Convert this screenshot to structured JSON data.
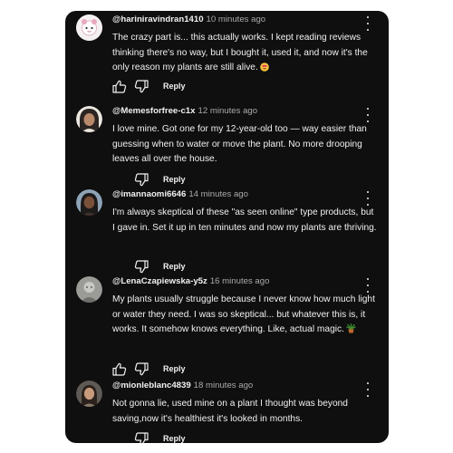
{
  "reply_label": "Reply",
  "comments": [
    {
      "handle": "@hariniravindran1410",
      "time": "10 minutes ago",
      "text": "The crazy part is... this actually works. I kept reading reviews thinking there's no way, but I bought it, used it, and now it's the only reason my plants are still alive.",
      "emoji": "heart-eyes-emoji",
      "show_like": true
    },
    {
      "handle": "@Memesforfree-c1x",
      "time": "12 minutes ago",
      "text": "I love mine. Got one for my 12-year-old too — way easier than guessing when to water or move the plant. No more drooping leaves all over the house.",
      "show_like": false
    },
    {
      "handle": "@imannaomi6646",
      "time": "14 minutes ago",
      "text": "I'm always skeptical of these \"as seen online\" type products, but I gave in. Set it up in ten minutes and now my plants are thriving.",
      "show_like": false
    },
    {
      "handle": "@LenaCzapiewska-y5z",
      "time": "16 minutes ago",
      "text": "My plants usually struggle because I never know how much light or water they need. I was so skeptical... but whatever this is, it works. It somehow knows everything. Like, actual magic.",
      "emoji": "potted-plant-emoji",
      "show_like": true
    },
    {
      "handle": "@mionleblanc4839",
      "time": "18 minutes ago",
      "text": "Not gonna lie, used mine on a plant I thought was beyond saving,now it's healthiest it's looked in months.",
      "show_like": false
    }
  ],
  "colors": {
    "background": "#0f0f0f",
    "text": "#f1f1f1",
    "meta": "#aaaaaa"
  }
}
